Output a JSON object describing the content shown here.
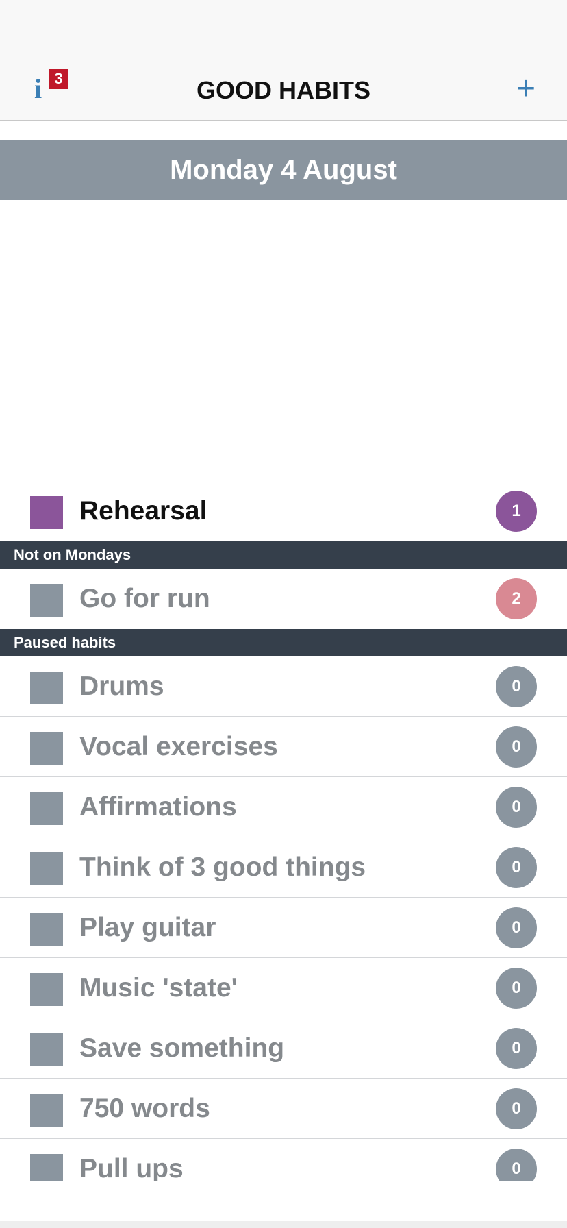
{
  "header": {
    "title": "GOOD HABITS",
    "info_badge": "3",
    "info_glyph": "i",
    "add_glyph": "+",
    "accent_color": "#3b7fb5",
    "badge_color": "#c0182a"
  },
  "date_banner": "Monday 4 August",
  "active_habits": [
    {
      "name": "Rehearsal",
      "count": "1",
      "color": "#8b559a",
      "count_color": "#8b559a"
    }
  ],
  "sections": [
    {
      "title": "Not on Mondays",
      "habits": [
        {
          "name": "Go for run",
          "count": "2",
          "count_color": "#d98993"
        }
      ]
    },
    {
      "title": "Paused habits",
      "habits": [
        {
          "name": "Drums",
          "count": "0"
        },
        {
          "name": "Vocal exercises",
          "count": "0"
        },
        {
          "name": "Affirmations",
          "count": "0"
        },
        {
          "name": "Think of 3 good things",
          "count": "0"
        },
        {
          "name": "Play guitar",
          "count": "0"
        },
        {
          "name": "Music 'state'",
          "count": "0"
        },
        {
          "name": "Save something",
          "count": "0"
        },
        {
          "name": "750 words",
          "count": "0"
        },
        {
          "name": "Pull ups",
          "count": "0"
        }
      ]
    }
  ]
}
